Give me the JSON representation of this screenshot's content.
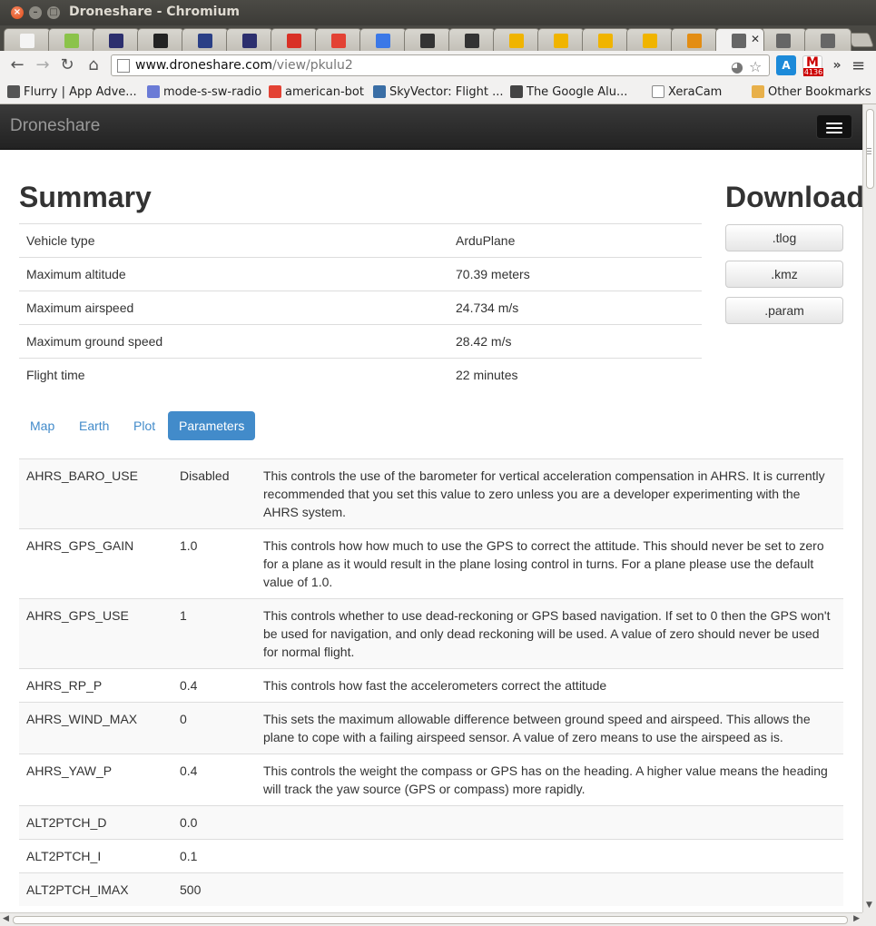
{
  "window": {
    "title": "Droneshare - Chromium"
  },
  "tabs": [
    {
      "icon": "page-icon",
      "color": "#f4f4f4"
    },
    {
      "icon": "android-icon",
      "color": "#8bc34a"
    },
    {
      "icon": "eclipse-icon",
      "color": "#2c2f6e"
    },
    {
      "icon": "starburst-icon",
      "color": "#222222"
    },
    {
      "icon": "barcode-icon",
      "color": "#2a3f86"
    },
    {
      "icon": "eclipse-icon",
      "color": "#2c2f6e"
    },
    {
      "icon": "gmail-icon",
      "color": "#d93025"
    },
    {
      "icon": "reddit-icon",
      "color": "#e34234"
    },
    {
      "icon": "google-icon",
      "color": "#3b78e7"
    },
    {
      "icon": "github-icon",
      "color": "#333333"
    },
    {
      "icon": "github-icon",
      "color": "#333333"
    },
    {
      "icon": "box-icon",
      "color": "#f0b400"
    },
    {
      "icon": "box-icon",
      "color": "#f0b400"
    },
    {
      "icon": "box-icon",
      "color": "#f0b400"
    },
    {
      "icon": "box-icon",
      "color": "#f0b400"
    },
    {
      "icon": "stack-icon",
      "color": "#e38d13"
    },
    {
      "icon": "plane-icon",
      "color": "#666666",
      "active": true
    },
    {
      "icon": "plane-icon",
      "color": "#666666"
    },
    {
      "icon": "plane-icon",
      "color": "#666666"
    }
  ],
  "toolbar": {
    "url_host": "www.droneshare.com",
    "url_path": "/view/pkulu2",
    "gmail_count": "4136"
  },
  "bookmarks": [
    {
      "label": "Flurry | App Adve...",
      "icon": "flurry-icon",
      "color": "#555555"
    },
    {
      "label": "mode-s-sw-radio",
      "icon": "project-icon",
      "color": "#6b7bd6"
    },
    {
      "label": "american-bot",
      "icon": "reddit-icon",
      "color": "#e34234"
    },
    {
      "label": "SkyVector: Flight ...",
      "icon": "skyvector-icon",
      "color": "#3a6ea5"
    },
    {
      "label": "The Google Alu...",
      "icon": "people-icon",
      "color": "#444444"
    },
    {
      "label": "XeraCam",
      "icon": "page-icon",
      "color": "#ffffff"
    },
    {
      "label": "Other Bookmarks",
      "icon": "folder-icon",
      "color": "#e8b04a"
    }
  ],
  "navbar": {
    "brand": "Droneshare"
  },
  "summary": {
    "heading": "Summary",
    "rows": [
      {
        "label": "Vehicle type",
        "value": "ArduPlane"
      },
      {
        "label": "Maximum altitude",
        "value": "70.39 meters"
      },
      {
        "label": "Maximum airspeed",
        "value": "24.734 m/s"
      },
      {
        "label": "Maximum ground speed",
        "value": "28.42 m/s"
      },
      {
        "label": "Flight time",
        "value": "22 minutes"
      }
    ]
  },
  "download": {
    "heading": "Download",
    "buttons": [
      ".tlog",
      ".kmz",
      ".param"
    ]
  },
  "tabs_nav": {
    "items": [
      "Map",
      "Earth",
      "Plot",
      "Parameters"
    ],
    "active": "Parameters"
  },
  "parameters": [
    {
      "name": "AHRS_BARO_USE",
      "value": "Disabled",
      "desc": "This controls the use of the barometer for vertical acceleration compensation in AHRS. It is currently recommended that you set this value to zero unless you are a developer experimenting with the AHRS system."
    },
    {
      "name": "AHRS_GPS_GAIN",
      "value": "1.0",
      "desc": "This controls how how much to use the GPS to correct the attitude. This should never be set to zero for a plane as it would result in the plane losing control in turns. For a plane please use the default value of 1.0."
    },
    {
      "name": "AHRS_GPS_USE",
      "value": "1",
      "desc": "This controls whether to use dead-reckoning or GPS based navigation. If set to 0 then the GPS won't be used for navigation, and only dead reckoning will be used. A value of zero should never be used for normal flight."
    },
    {
      "name": "AHRS_RP_P",
      "value": "0.4",
      "desc": "This controls how fast the accelerometers correct the attitude"
    },
    {
      "name": "AHRS_WIND_MAX",
      "value": "0",
      "desc": "This sets the maximum allowable difference between ground speed and airspeed. This allows the plane to cope with a failing airspeed sensor. A value of zero means to use the airspeed as is."
    },
    {
      "name": "AHRS_YAW_P",
      "value": "0.4",
      "desc": "This controls the weight the compass or GPS has on the heading. A higher value means the heading will track the yaw source (GPS or compass) more rapidly."
    },
    {
      "name": "ALT2PTCH_D",
      "value": "0.0",
      "desc": ""
    },
    {
      "name": "ALT2PTCH_I",
      "value": "0.1",
      "desc": ""
    },
    {
      "name": "ALT2PTCH_IMAX",
      "value": "500",
      "desc": ""
    }
  ]
}
